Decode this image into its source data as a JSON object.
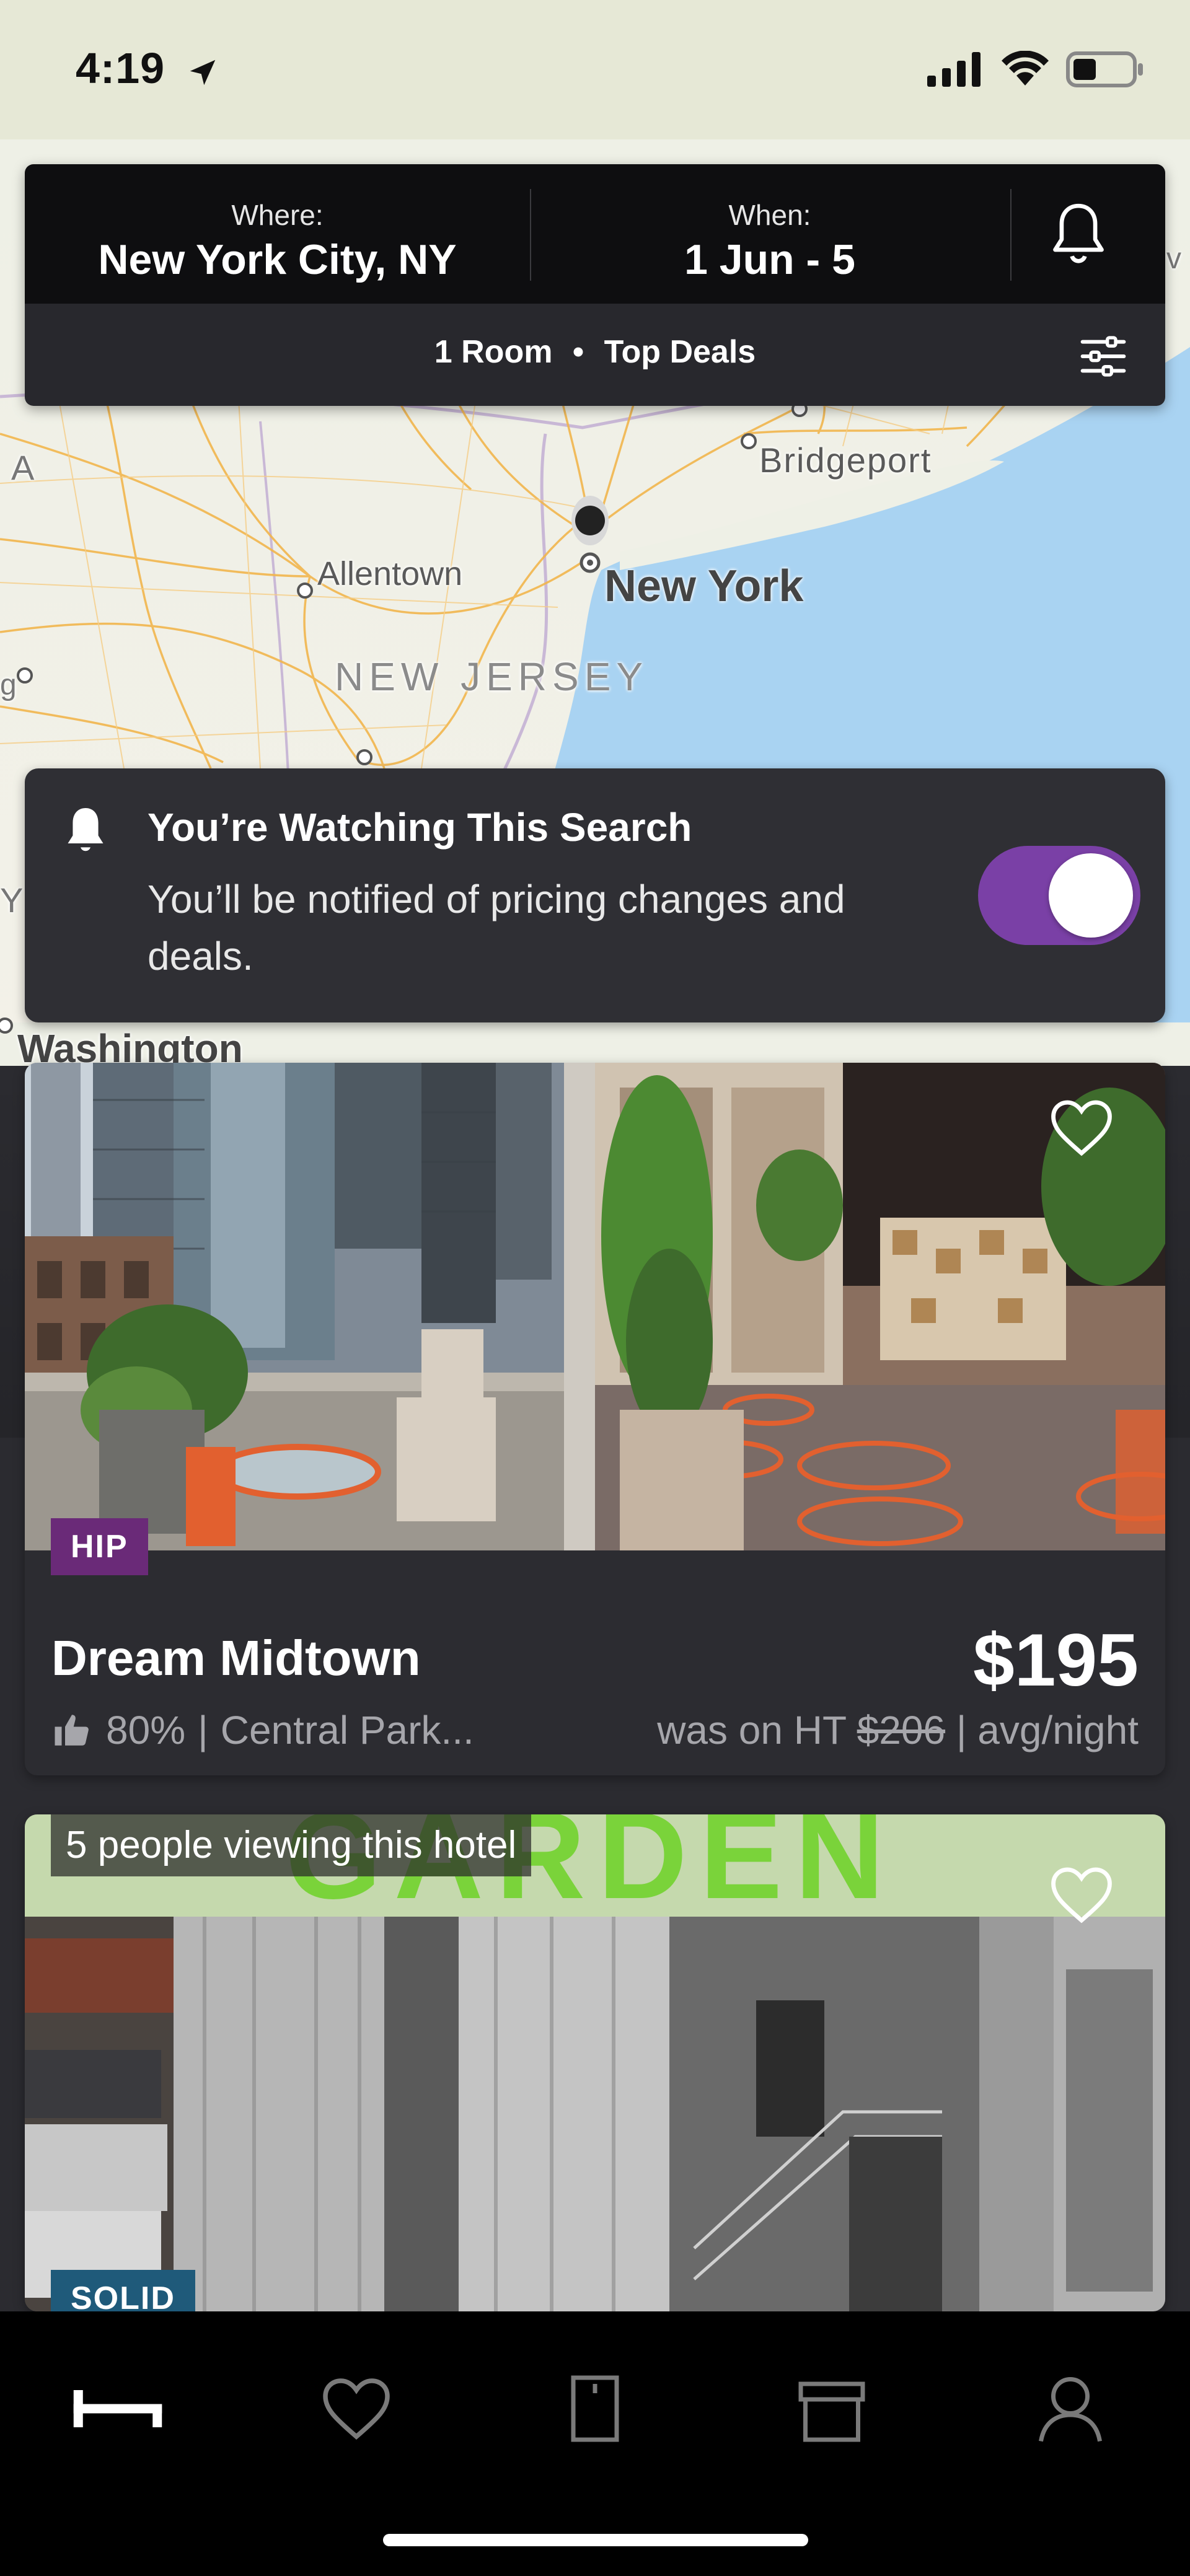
{
  "status_bar": {
    "time": "4:19",
    "icons": [
      "location-arrow-icon",
      "cellular-signal-icon",
      "wifi-icon",
      "battery-icon"
    ]
  },
  "search": {
    "where_label": "Where:",
    "where_value": "New York City, NY",
    "when_label": "When:",
    "when_value": "1 Jun - 5",
    "rooms": "1 Room",
    "separator": "•",
    "sort": "Top Deals",
    "icons": [
      "bell-icon",
      "filter-sliders-icon"
    ]
  },
  "map": {
    "labels": {
      "bridgeport": "Bridgeport",
      "allentown": "Allentown",
      "new_york": "New York",
      "new_jersey": "NEW JERSEY",
      "washington": "Washington",
      "left_a": "A",
      "left_g": "g",
      "left_y": "Y",
      "right_v": "v"
    }
  },
  "watch_banner": {
    "title": "You’re Watching This Search",
    "subtitle": "You’ll be notified of pricing changes and deals.",
    "toggle_on": true,
    "toggle_color": "#7a40a6"
  },
  "hotels": [
    {
      "tag": "HIP",
      "tag_color": "#6a2a78",
      "name": "Dream Midtown",
      "price": "$195",
      "rating": "80%",
      "area": "Central Park...",
      "was_prefix": "was on HT",
      "was_price": "$206",
      "per_night": "| avg/night",
      "separator": "|"
    },
    {
      "viewers": "5 people viewing this hotel",
      "sign_text": "GARDEN",
      "tag": "SOLID",
      "tag_color": "#1f5a7a"
    }
  ],
  "tabbar": {
    "tabs": [
      "hotels-bed-icon",
      "favorites-heart-icon",
      "bookings-door-icon",
      "rewards-gift-icon",
      "profile-person-icon"
    ],
    "active": "hotels-bed-icon"
  }
}
